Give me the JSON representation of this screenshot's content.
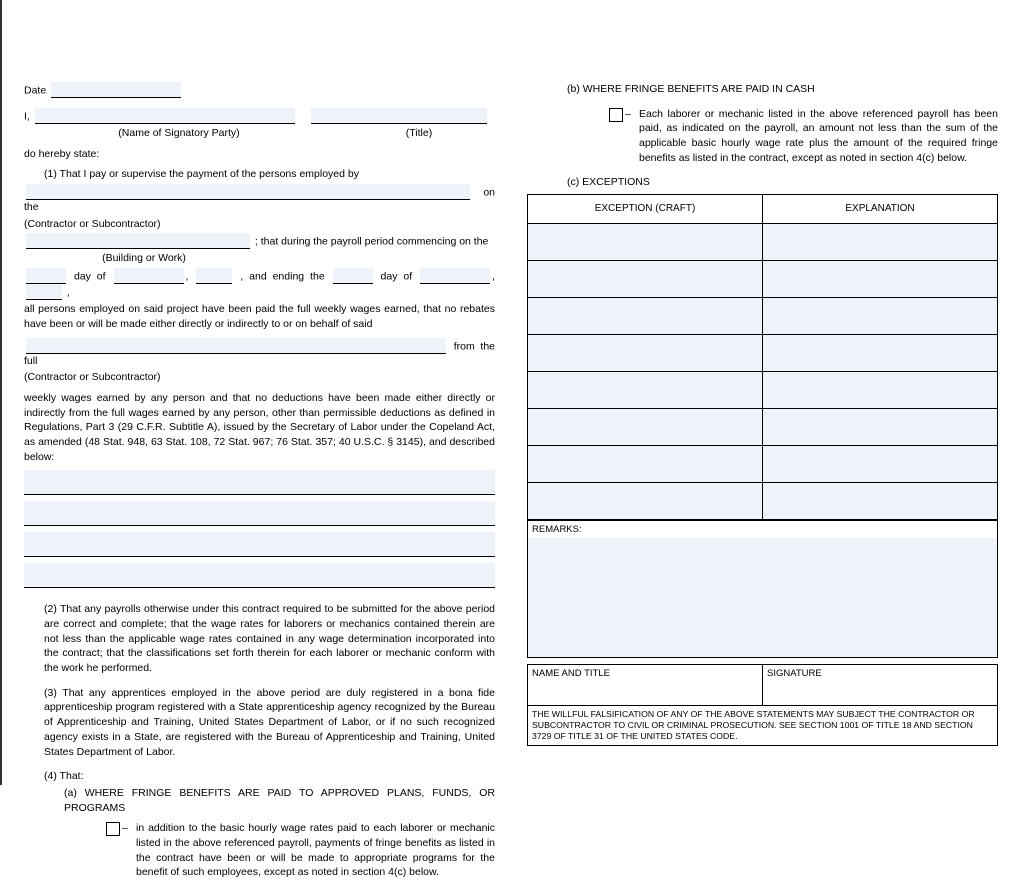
{
  "left": {
    "date_label": "Date",
    "i_label": "I,",
    "name_caption": "(Name of Signatory Party)",
    "title_caption": "(Title)",
    "hereby": "do hereby state:",
    "para1_lead": "(1) That I pay or supervise the payment of the persons employed by",
    "on_the": " on the",
    "contractor_caption": "(Contractor or Subcontractor)",
    "payroll_period": "; that during the payroll period commencing on the",
    "building_caption": "(Building or Work)",
    "day_of_1a": " day of ",
    "and_ending": ", and ending the ",
    "day_of_1b": " day of ",
    "comma_tail": " ,",
    "all_persons": "all persons employed on said project have been paid the full weekly wages earned,  that no rebates have been or will be made either directly or indirectly to or on behalf of said",
    "from_the_full": " from the full",
    "contractor_caption2": "(Contractor or Subcontractor)",
    "weekly_para": "weekly wages earned by any person and that no deductions have been made either directly or indirectly from the full wages earned by any person, other than permissible deductions as defined in Regulations, Part 3 (29 C.F.R. Subtitle A), issued by the Secretary of Labor under the Copeland Act, as amended (48 Stat. 948, 63 Stat. 108, 72 Stat. 967; 76 Stat. 357; 40 U.S.C. § 3145), and described below:",
    "para2": "(2) That any payrolls otherwise under this contract required to be submitted for the above period are correct and complete; that the wage rates for laborers or mechanics contained therein are not less than the applicable wage rates contained in any wage determination incorporated into the contract; that the classifications set forth therein for each laborer or mechanic conform with the work he performed.",
    "para3": "(3) That any apprentices employed in the above period are duly registered in a bona fide apprenticeship program registered with a State apprenticeship agency recognized by the Bureau of Apprenticeship and Training, United States Department of Labor, or if no such recognized agency exists in a State, are registered with the Bureau of Apprenticeship and Training, United States Department of Labor.",
    "para4_lead": "(4) That:",
    "para4a": "(a) WHERE FRINGE BENEFITS ARE PAID TO APPROVED PLANS, FUNDS, OR PROGRAMS",
    "bullet_a": "in addition to the basic hourly wage rates paid to each laborer or  mechanic listed in the above referenced payroll, payments of fringe benefits as listed in  the contract have been or will be made to appropriate programs for the benefit of such employees, except as noted in section 4(c) below."
  },
  "right": {
    "para4b": "(b) WHERE FRINGE BENEFITS ARE PAID IN CASH",
    "bullet_b": "Each laborer or mechanic listed in the above referenced payroll has been paid, as indicated on the payroll, an amount not less than the sum of the applicable basic hourly wage rate plus the amount of the required fringe benefits as listed in the contract, except as noted in section 4(c) below.",
    "para4c": "(c) EXCEPTIONS",
    "th1": "EXCEPTION (CRAFT)",
    "th2": "EXPLANATION",
    "remarks_lbl": "REMARKS:",
    "name_title": "NAME AND TITLE",
    "signature": "SIGNATURE",
    "fineprint": "THE  WILLFUL   FALSIFICATION OF ANY OF THE ABOVE STATEMENTS MAY SUBJECT THE CONTRACTOR OR SUBCONTRACTOR TO CIVIL OR CRIMINAL PROSECUTION. SEE SECTION 1001 OF TITLE 18 AND SECTION 3729 OF TITLE 31 OF THE UNITED STATES CODE."
  }
}
